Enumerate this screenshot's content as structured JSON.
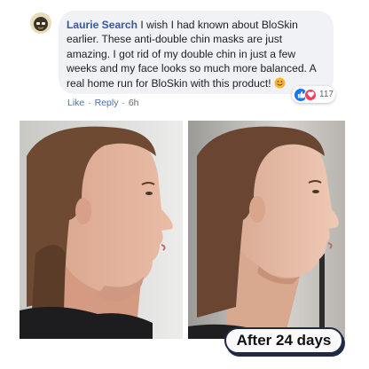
{
  "comment": {
    "author": "Laurie Search",
    "text": " I wish I had known about BloSkin earlier. These anti-double chin masks are just amazing. I got rid of my double chin in just a few weeks and my face looks so much more balanced. A real home run for BloSkin with this product! ",
    "emoji": "smiling-face-emoji",
    "avatar": "avatar-icon"
  },
  "reactions": {
    "icons": [
      "like-icon",
      "love-icon"
    ],
    "count": "117",
    "like_color": "#1877f2",
    "love_color": "#f33e58"
  },
  "actions": {
    "like_label": "Like",
    "separator": "·",
    "reply_label": "Reply",
    "time": "6h"
  },
  "photos": {
    "before": "before-photo",
    "after": "after-photo",
    "after_badge": "After 24 days"
  },
  "colors": {
    "author_link": "#385898",
    "bubble_bg": "#f0f2f5",
    "badge_border": "#1f2a44"
  }
}
